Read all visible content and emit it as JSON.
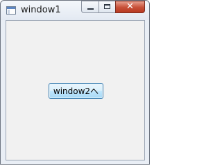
{
  "window": {
    "title": "window1",
    "controls": {
      "minimize_icon": "minimize-icon",
      "maximize_icon": "maximize-icon",
      "close_glyph": "✕"
    }
  },
  "content": {
    "button_label": "window2へ"
  },
  "colors": {
    "close_button": "#c74f37",
    "button_border": "#3c7fb1",
    "client_background": "#f1f1f1"
  }
}
